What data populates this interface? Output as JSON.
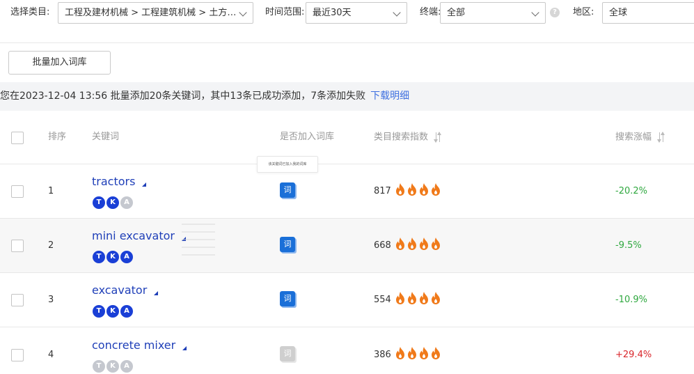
{
  "filters": {
    "category_label": "选择类目:",
    "category_value": "工程及建材机械 > 工程建筑机械 > 土方…",
    "time_label": "时间范围:",
    "time_value": "最近30天",
    "terminal_label": "终端:",
    "terminal_value": "全部",
    "region_label": "地区:",
    "region_value": "全球"
  },
  "batch_button": "批量加入词库",
  "notice": {
    "text": "您在2023-12-04 13:56 批量添加20条关键词，其中13条已成功添加，7条添加失败",
    "link": "下载明细"
  },
  "table": {
    "headers": {
      "rank": "排序",
      "keyword": "关键词",
      "in_lib": "是否加入词库",
      "index": "类目搜索指数",
      "change": "搜索涨幅"
    },
    "tooltip": "该关键词已加入我的词库",
    "ci_label": "词",
    "badges": [
      "T",
      "K",
      "A"
    ],
    "rows": [
      {
        "rank": "1",
        "keyword": "tractors",
        "in_lib": true,
        "index": "817",
        "fires": 4,
        "change": "-20.2%",
        "trend": "down"
      },
      {
        "rank": "2",
        "keyword": "mini excavator",
        "in_lib": true,
        "index": "668",
        "fires": 4,
        "change": "-9.5%",
        "trend": "down"
      },
      {
        "rank": "3",
        "keyword": "excavator",
        "in_lib": true,
        "index": "554",
        "fires": 4,
        "change": "-10.9%",
        "trend": "down"
      },
      {
        "rank": "4",
        "keyword": "concrete mixer",
        "in_lib": false,
        "index": "386",
        "fires": 4,
        "change": "+29.4%",
        "trend": "up"
      }
    ]
  },
  "colors": {
    "link": "#3d6fe0",
    "keyword": "#1f3fb8",
    "badge": "#1a3fd6",
    "fire": "#f07a1a",
    "down": "#2fa83f",
    "up": "#d9262b"
  }
}
